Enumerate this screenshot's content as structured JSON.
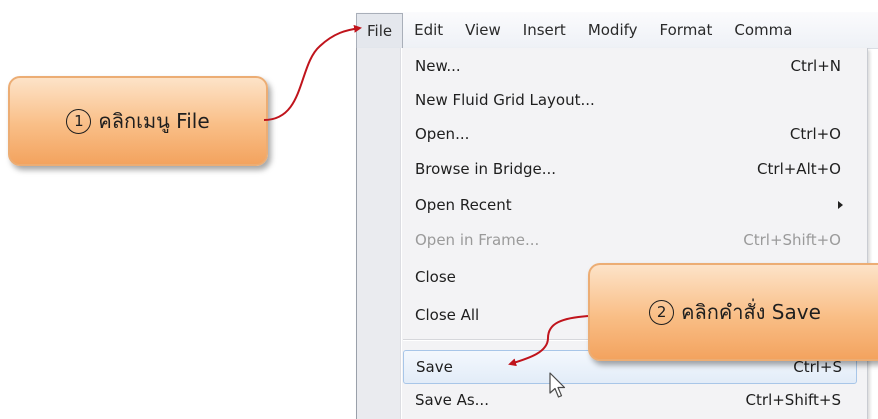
{
  "menubar": {
    "items": [
      "File",
      "Edit",
      "View",
      "Insert",
      "Modify",
      "Format",
      "Comma"
    ],
    "active": "File"
  },
  "file_menu": {
    "items": [
      {
        "label": "New...",
        "shortcut": "Ctrl+N"
      },
      {
        "label": "New Fluid Grid Layout...",
        "shortcut": ""
      },
      {
        "label": "Open...",
        "shortcut": "Ctrl+O"
      },
      {
        "label": "Browse in Bridge...",
        "shortcut": "Ctrl+Alt+O"
      },
      {
        "label": "Open Recent",
        "shortcut": ""
      },
      {
        "label": "Open in Frame...",
        "shortcut": "Ctrl+Shift+O"
      },
      {
        "label": "Close",
        "shortcut": ""
      },
      {
        "label": "Close All",
        "shortcut": ""
      },
      {
        "label": "Save",
        "shortcut": "Ctrl+S"
      },
      {
        "label": "Save As...",
        "shortcut": "Ctrl+Shift+S"
      }
    ]
  },
  "callouts": {
    "step1": {
      "number": "1",
      "text": "คลิกเมนู File"
    },
    "step2": {
      "number": "2",
      "text": "คลิกคำสั่ง Save"
    }
  },
  "colors": {
    "callout_fill": "#f9be86",
    "arrow": "#c0141c",
    "hover_highlight": "#e2ecf8"
  },
  "icons": {
    "submenu": "chevron-right-icon",
    "cursor": "mouse-pointer-icon"
  }
}
